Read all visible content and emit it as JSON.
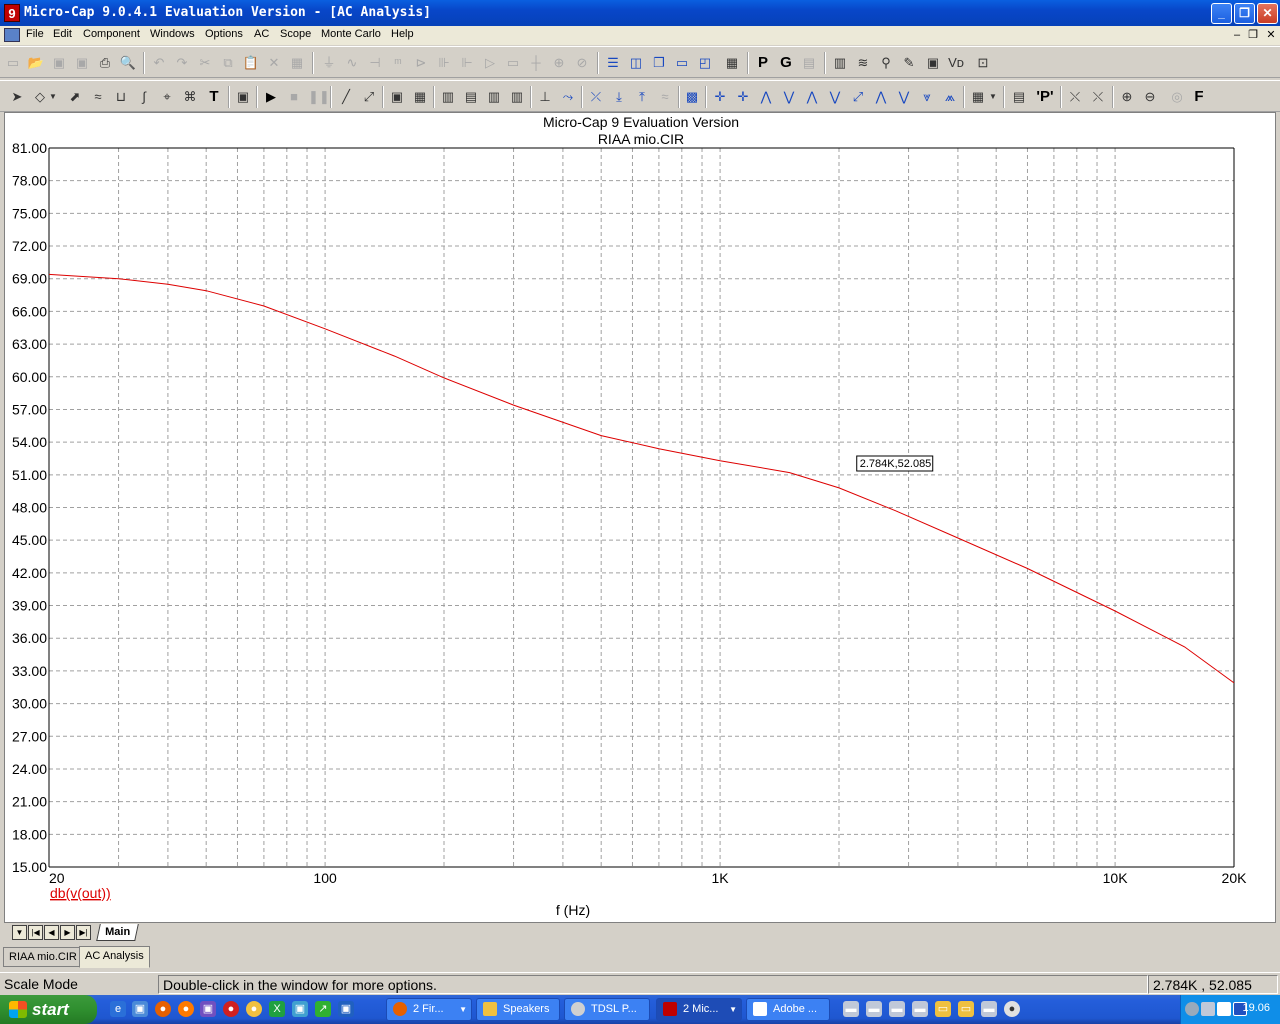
{
  "window": {
    "title": "Micro-Cap 9.0.4.1 Evaluation Version - [AC Analysis]",
    "app_icon": "9"
  },
  "menu": [
    "File",
    "Edit",
    "Component",
    "Windows",
    "Options",
    "AC",
    "Scope",
    "Monte Carlo",
    "Help"
  ],
  "plot": {
    "title_line1": "Micro-Cap 9 Evaluation Version",
    "title_line2": "RIAA mio.CIR",
    "x_axis_label": "f (Hz)",
    "trace_label": "db(v(out))",
    "cursor_label": "2.784K,52.085",
    "colors": {
      "trace": "#dd0000",
      "grid": "#a0a0a0",
      "background": "#ffffff"
    }
  },
  "chart_data": {
    "type": "line",
    "title": "Micro-Cap 9 Evaluation Version",
    "subtitle": "RIAA mio.CIR",
    "xlabel": "f (Hz)",
    "ylabel": "",
    "xscale": "log",
    "xlim": [
      20,
      20000
    ],
    "ylim": [
      15,
      81
    ],
    "x_tick_labels": [
      "20",
      "100",
      "1K",
      "10K",
      "20K"
    ],
    "x_tick_values": [
      20,
      100,
      1000,
      10000,
      20000
    ],
    "y_tick_labels": [
      "15.00",
      "18.00",
      "21.00",
      "24.00",
      "27.00",
      "30.00",
      "33.00",
      "36.00",
      "39.00",
      "42.00",
      "45.00",
      "48.00",
      "51.00",
      "54.00",
      "57.00",
      "60.00",
      "63.00",
      "66.00",
      "69.00",
      "72.00",
      "75.00",
      "78.00",
      "81.00"
    ],
    "grid": true,
    "series": [
      {
        "name": "db(v(out))",
        "color": "#dd0000",
        "x": [
          20,
          30,
          40,
          50,
          70,
          100,
          150,
          200,
          300,
          500,
          700,
          1000,
          1500,
          2000,
          2784,
          4000,
          6000,
          10000,
          15000,
          20000
        ],
        "y": [
          69.4,
          69.0,
          68.5,
          67.9,
          66.5,
          64.4,
          61.9,
          59.9,
          57.4,
          54.6,
          53.4,
          52.3,
          51.2,
          49.8,
          47.7,
          45.2,
          42.4,
          38.5,
          35.2,
          31.9
        ]
      }
    ],
    "annotations": [
      {
        "text": "2.784K,52.085",
        "x": 2784,
        "y": 52.085
      }
    ]
  },
  "tabs": {
    "main": "Main"
  },
  "doc_tabs": [
    {
      "label": "RIAA mio.CIR"
    },
    {
      "label": "AC Analysis"
    }
  ],
  "status": {
    "mode": "Scale Mode",
    "hint": "Double-click in the window for more options.",
    "coords": "2.784K , 52.085"
  },
  "taskbar": {
    "start": "start",
    "tasks": [
      {
        "label": "2 Fir...",
        "icon_color": "#e66000"
      },
      {
        "label": "Speakers",
        "icon_color": "#f0c040"
      },
      {
        "label": "TDSL P...",
        "icon_color": "#d0d0d0"
      },
      {
        "label": "2 Mic...",
        "icon_color": "#c00000"
      },
      {
        "label": "Adobe ...",
        "icon_color": "#ffffff"
      }
    ],
    "clock": "19.06"
  }
}
